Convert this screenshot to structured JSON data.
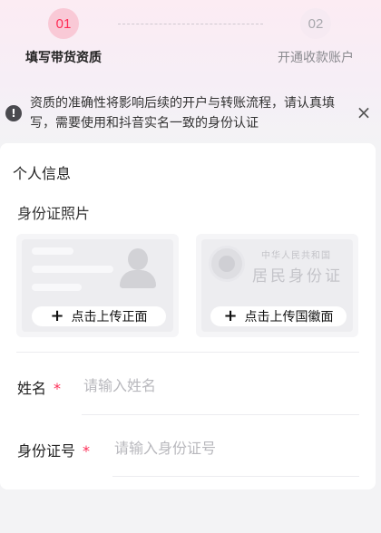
{
  "steps": [
    {
      "number": "01",
      "label": "填写带货资质"
    },
    {
      "number": "02",
      "label": "开通收款账户"
    }
  ],
  "notice": {
    "text": "资质的准确性将影响后续的开户与转账流程，请认真填写，需要使用和抖音实名一致的身份认证",
    "icon": "info-icon",
    "close": "×"
  },
  "form": {
    "section_title": "个人信息",
    "photo_title": "身份证照片",
    "front": {
      "label": "点击上传正面"
    },
    "back": {
      "label": "点击上传国徽面",
      "card_small": "中华人民共和国",
      "card_big": "居民身份证"
    },
    "name": {
      "label": "姓名",
      "required": "*",
      "placeholder": "请输入姓名"
    },
    "id_number": {
      "label": "身份证号",
      "required": "*",
      "placeholder": "请输入身份证号"
    }
  },
  "colors": {
    "accent": "#fe2c55"
  }
}
